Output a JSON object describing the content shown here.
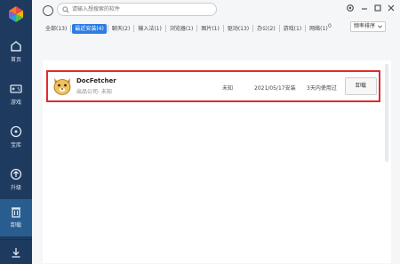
{
  "sidebar": {
    "items": [
      {
        "label": "首页",
        "icon": "home-icon"
      },
      {
        "label": "游戏",
        "icon": "gamepad-icon"
      },
      {
        "label": "宝库",
        "icon": "treasure-icon"
      },
      {
        "label": "升级",
        "icon": "upgrade-icon"
      },
      {
        "label": "卸载",
        "icon": "trash-icon"
      }
    ],
    "active_index": 4,
    "bottom_icon": "download-icon"
  },
  "search": {
    "placeholder": "请输入想搜索的软件"
  },
  "window_controls": [
    "settings-icon",
    "minimize-icon",
    "maximize-icon",
    "close-icon"
  ],
  "tabs": [
    "全部(13)",
    "最近安装(4)",
    "聊天(2)",
    "输入法(1)",
    "浏览器(1)",
    "图片(1)",
    "驱动(13)",
    "办公(2)",
    "游戏(1)",
    "网络(1)"
  ],
  "active_tab_index": 1,
  "trailing_count": "0",
  "sort": {
    "selected": "频率排序"
  },
  "apps": [
    {
      "name": "DocFetcher",
      "publisher": "出品公司: 未知",
      "size": "未知",
      "install_date": "2021/05/17安装",
      "usage": "3天内使用过",
      "action": "卸载"
    }
  ],
  "colors": {
    "sidebar_bg": "#1e3a5f",
    "sidebar_active": "#2a5d8f",
    "tab_active": "#2b7de3",
    "highlight_border": "#e02b2b"
  }
}
